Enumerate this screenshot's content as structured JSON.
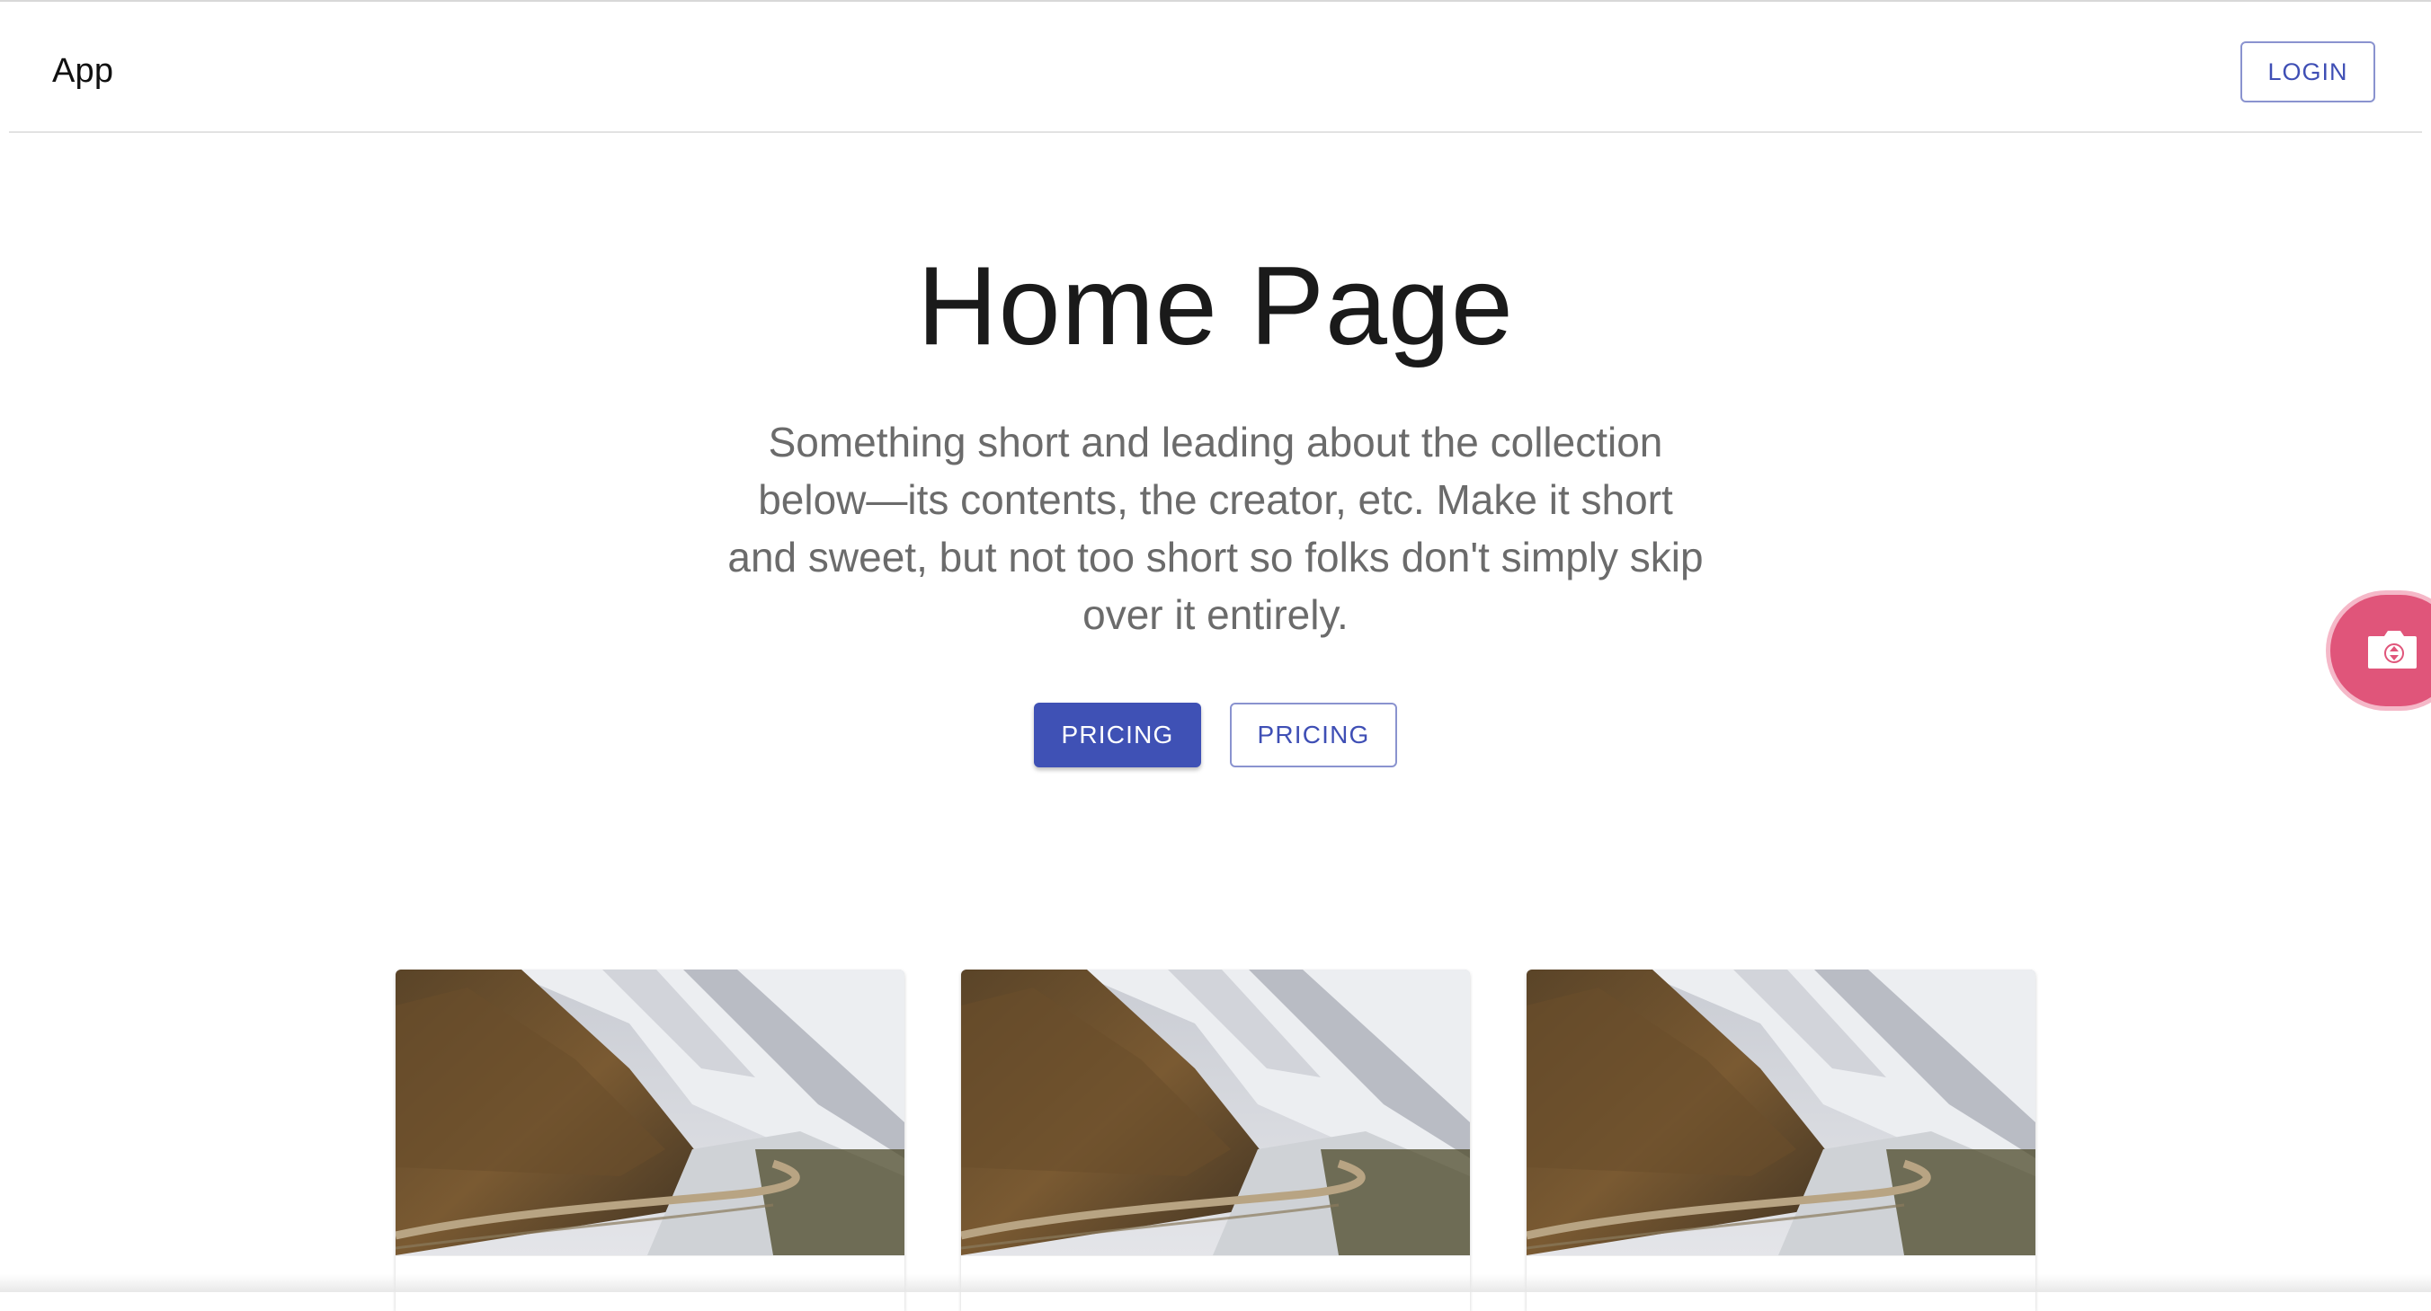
{
  "appbar": {
    "title": "App",
    "login_label": "LOGIN"
  },
  "hero": {
    "title": "Home Page",
    "subtitle": "Something short and leading about the collection below—its contents, the creator, etc. Make it short and sweet, but not too short so folks don't simply skip over it entirely.",
    "primary_button": "PRICING",
    "secondary_button": "PRICING"
  },
  "floating_action": {
    "icon": "folder-camera-icon",
    "color": "#e0557a"
  },
  "cards": [
    {
      "image": "mountain-road-image"
    },
    {
      "image": "mountain-road-image"
    },
    {
      "image": "mountain-road-image"
    }
  ],
  "colors": {
    "primary": "#3f51b5",
    "accent": "#e0557a"
  }
}
